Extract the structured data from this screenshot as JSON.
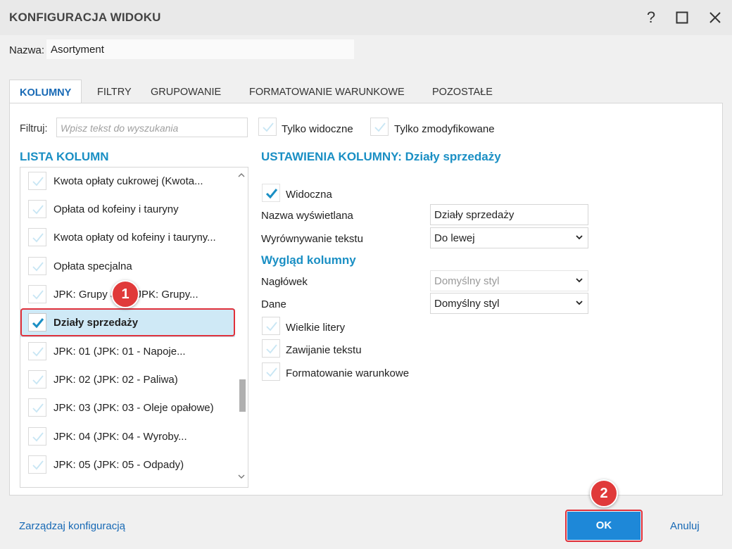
{
  "window": {
    "title": "KONFIGURACJA WIDOKU",
    "help_glyph": "?",
    "maximize_glyph": "☐",
    "close_glyph": "✕"
  },
  "name_row": {
    "label": "Nazwa:",
    "value": "Asortyment"
  },
  "tabs": [
    {
      "label": "KOLUMNY",
      "active": true
    },
    {
      "label": "FILTRY",
      "active": false
    },
    {
      "label": "GRUPOWANIE",
      "active": false
    },
    {
      "label": "FORMATOWANIE WARUNKOWE",
      "active": false
    },
    {
      "label": "POZOSTAŁE",
      "active": false
    }
  ],
  "filter": {
    "label": "Filtruj:",
    "placeholder": "Wpisz tekst do wyszukania",
    "only_visible": "Tylko widoczne",
    "only_modified": "Tylko zmodyfikowane"
  },
  "column_list": {
    "title": "LISTA KOLUMN",
    "items": [
      {
        "label": "Kwota opłaty cukrowej (Kwota...",
        "selected": false
      },
      {
        "label": "Opłata od kofeiny i tauryny",
        "selected": false
      },
      {
        "label": "Kwota opłaty od kofeiny i tauryny...",
        "selected": false
      },
      {
        "label": "Opłata specjalna",
        "selected": false
      },
      {
        "label": "JPK: Grupy JPK (JPK: Grupy...",
        "selected": false
      },
      {
        "label": "Działy sprzedaży",
        "selected": true
      },
      {
        "label": "JPK: 01 (JPK: 01 - Napoje...",
        "selected": false
      },
      {
        "label": "JPK: 02 (JPK: 02 - Paliwa)",
        "selected": false
      },
      {
        "label": "JPK: 03 (JPK: 03 - Oleje opałowe)",
        "selected": false
      },
      {
        "label": "JPK: 04 (JPK: 04 - Wyroby...",
        "selected": false
      },
      {
        "label": "JPK: 05 (JPK: 05 - Odpady)",
        "selected": false
      }
    ]
  },
  "settings": {
    "title": "USTAWIENIA KOLUMNY: Działy sprzedaży",
    "visible_label": "Widoczna",
    "display_name_label": "Nazwa wyświetlana",
    "display_name_value": "Działy sprzedaży",
    "align_label": "Wyrównywanie tekstu",
    "align_value": "Do lewej",
    "appearance_title": "Wygląd kolumny",
    "header_label": "Nagłówek",
    "header_value": "Domyślny styl",
    "data_label": "Dane",
    "data_value": "Domyślny styl",
    "uppercase_label": "Wielkie litery",
    "wrap_label": "Zawijanie tekstu",
    "conditional_label": "Formatowanie warunkowe"
  },
  "footer": {
    "manage_link": "Zarządzaj konfiguracją",
    "ok_label": "OK",
    "cancel_label": "Anuluj"
  },
  "annotations": {
    "badge_1": "1",
    "badge_2": "2"
  },
  "colors": {
    "accent": "#1a8fc4",
    "link": "#1769b5",
    "ok_button": "#1e88d8",
    "highlight": "#e0303a",
    "selection": "#cfe9f6"
  }
}
